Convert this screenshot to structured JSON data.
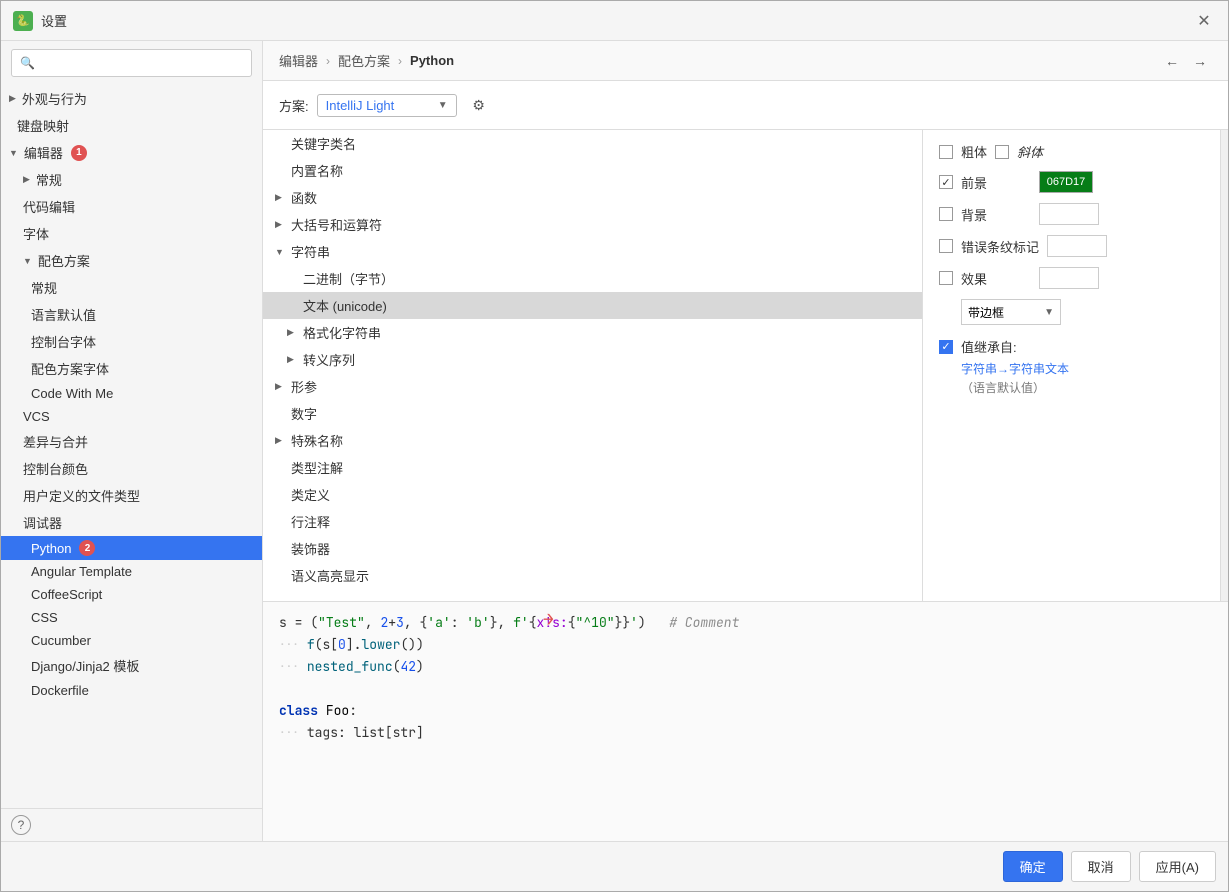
{
  "window": {
    "title": "设置",
    "icon": "⚙"
  },
  "titlebar": {
    "title": "设置",
    "close_btn": "✕"
  },
  "search": {
    "placeholder": ""
  },
  "sidebar": {
    "items": [
      {
        "id": "appearance",
        "label": "外观与行为",
        "indent": 0,
        "expandable": true,
        "expanded": false
      },
      {
        "id": "keymap",
        "label": "键盘映射",
        "indent": 0,
        "expandable": false
      },
      {
        "id": "editor",
        "label": "编辑器",
        "indent": 0,
        "badge": "1",
        "expanded": true
      },
      {
        "id": "general",
        "label": "常规",
        "indent": 1,
        "expandable": true
      },
      {
        "id": "code-editing",
        "label": "代码编辑",
        "indent": 1
      },
      {
        "id": "font",
        "label": "字体",
        "indent": 1
      },
      {
        "id": "color-scheme",
        "label": "配色方案",
        "indent": 1,
        "expanded": true
      },
      {
        "id": "scheme-general",
        "label": "常规",
        "indent": 2
      },
      {
        "id": "lang-default",
        "label": "语言默认值",
        "indent": 2
      },
      {
        "id": "console-font",
        "label": "控制台字体",
        "indent": 2
      },
      {
        "id": "scheme-font",
        "label": "配色方案字体",
        "indent": 2
      },
      {
        "id": "code-with-me",
        "label": "Code With Me",
        "indent": 2
      },
      {
        "id": "vcs",
        "label": "VCS",
        "indent": 1
      },
      {
        "id": "diff-merge",
        "label": "差异与合并",
        "indent": 1
      },
      {
        "id": "console-colors",
        "label": "控制台颜色",
        "indent": 1
      },
      {
        "id": "file-types",
        "label": "用户定义的文件类型",
        "indent": 1
      },
      {
        "id": "debugger",
        "label": "调试器",
        "indent": 1
      },
      {
        "id": "python",
        "label": "Python",
        "indent": 2,
        "active": true,
        "badge": "2"
      },
      {
        "id": "angular",
        "label": "Angular Template",
        "indent": 2
      },
      {
        "id": "coffeescript",
        "label": "CoffeeScript",
        "indent": 2
      },
      {
        "id": "css",
        "label": "CSS",
        "indent": 2
      },
      {
        "id": "cucumber",
        "label": "Cucumber",
        "indent": 2
      },
      {
        "id": "django",
        "label": "Django/Jinja2 模板",
        "indent": 2
      },
      {
        "id": "dockerfile",
        "label": "Dockerfile",
        "indent": 2
      }
    ],
    "help_btn": "?"
  },
  "breadcrumb": {
    "items": [
      "编辑器",
      "配色方案",
      "Python"
    ],
    "separators": [
      "›",
      "›"
    ],
    "nav_back": "←",
    "nav_forward": "→"
  },
  "scheme": {
    "label": "方案:",
    "value": "IntelliJ Light",
    "gear_icon": "⚙"
  },
  "tree": {
    "items": [
      {
        "label": "关键字类名",
        "indent": 0,
        "expandable": false
      },
      {
        "label": "内置名称",
        "indent": 0,
        "expandable": false
      },
      {
        "label": "函数",
        "indent": 0,
        "expandable": true,
        "expanded": false
      },
      {
        "label": "大括号和运算符",
        "indent": 0,
        "expandable": true,
        "expanded": false
      },
      {
        "label": "字符串",
        "indent": 0,
        "expandable": true,
        "expanded": true
      },
      {
        "label": "二进制（字节）",
        "indent": 1,
        "expandable": false
      },
      {
        "label": "文本 (unicode)",
        "indent": 1,
        "expandable": false,
        "selected": true
      },
      {
        "label": "格式化字符串",
        "indent": 1,
        "expandable": true,
        "expanded": false
      },
      {
        "label": "转义序列",
        "indent": 1,
        "expandable": true,
        "expanded": false
      },
      {
        "label": "形参",
        "indent": 0,
        "expandable": true,
        "expanded": false
      },
      {
        "label": "数字",
        "indent": 0,
        "expandable": false
      },
      {
        "label": "特殊名称",
        "indent": 0,
        "expandable": true,
        "expanded": false
      },
      {
        "label": "类型注解",
        "indent": 0,
        "expandable": false
      },
      {
        "label": "类定义",
        "indent": 0,
        "expandable": false
      },
      {
        "label": "行注释",
        "indent": 0,
        "expandable": false
      },
      {
        "label": "装饰器",
        "indent": 0,
        "expandable": false
      },
      {
        "label": "语义高亮显示",
        "indent": 0,
        "expandable": false
      }
    ]
  },
  "properties": {
    "bold_label": "粗体",
    "italic_label": "斜体",
    "foreground_label": "前景",
    "foreground_value": "067D17",
    "background_label": "背景",
    "error_stripe_label": "错误条纹标记",
    "effects_label": "效果",
    "border_label": "带边框",
    "inherit_label": "值继承自:",
    "inherit_link": "字符串→字符串文本",
    "inherit_sublabel": "（语言默认值）"
  },
  "preview": {
    "lines": [
      {
        "type": "code",
        "content": "s = (\"Test\", 2+3, {'a': 'b'}, f'{x!s:{\"^10\"}}')   # Comment"
      },
      {
        "type": "code",
        "content": "    f(s[0].lower())"
      },
      {
        "type": "code",
        "content": "    nested_func(42)"
      },
      {
        "type": "code",
        "content": ""
      },
      {
        "type": "code",
        "content": "class Foo:"
      },
      {
        "type": "code",
        "content": "    tags: list[str]"
      }
    ]
  },
  "bottom": {
    "ok_btn": "确定",
    "cancel_btn": "取消",
    "apply_btn": "应用(A)"
  }
}
